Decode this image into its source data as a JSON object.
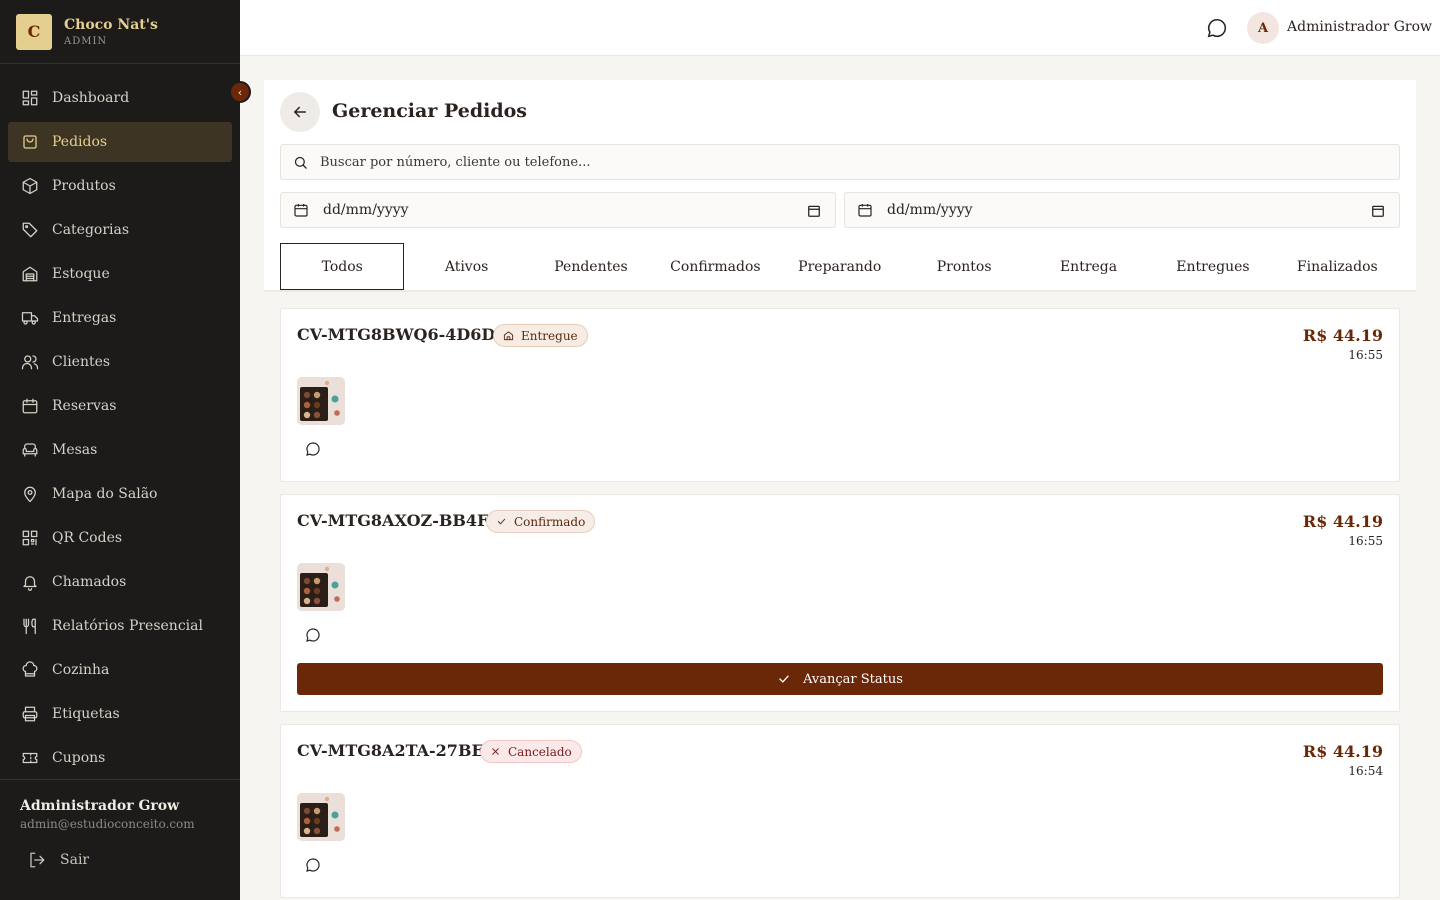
{
  "brand": {
    "initial": "C",
    "name": "Choco Nat's",
    "subtitle": "ADMIN"
  },
  "sidebar": {
    "items": [
      {
        "label": "Dashboard",
        "icon": "dashboard-icon"
      },
      {
        "label": "Pedidos",
        "icon": "shopping-bag-icon",
        "active": true
      },
      {
        "label": "Produtos",
        "icon": "package-icon"
      },
      {
        "label": "Categorias",
        "icon": "tag-icon"
      },
      {
        "label": "Estoque",
        "icon": "warehouse-icon"
      },
      {
        "label": "Entregas",
        "icon": "truck-icon"
      },
      {
        "label": "Clientes",
        "icon": "users-icon"
      },
      {
        "label": "Reservas",
        "icon": "calendar-icon"
      },
      {
        "label": "Mesas",
        "icon": "sofa-icon"
      },
      {
        "label": "Mapa do Salão",
        "icon": "map-pin-icon"
      },
      {
        "label": "QR Codes",
        "icon": "qr-code-icon"
      },
      {
        "label": "Chamados",
        "icon": "bell-icon"
      },
      {
        "label": "Relatórios Presencial",
        "icon": "utensils-icon"
      },
      {
        "label": "Cozinha",
        "icon": "chef-hat-icon"
      },
      {
        "label": "Etiquetas",
        "icon": "printer-icon"
      },
      {
        "label": "Cupons",
        "icon": "ticket-icon"
      }
    ],
    "collapse_glyph": "‹",
    "footer": {
      "name": "Administrador Grow",
      "email": "admin@estudioconceito.com",
      "logout_label": "Sair"
    }
  },
  "topbar": {
    "avatar_initial": "A",
    "user_name": "Administrador Grow"
  },
  "page": {
    "title": "Gerenciar Pedidos",
    "search_placeholder": "Buscar por número, cliente ou telefone...",
    "date_from": "dd/mm/yyyy",
    "date_to": "dd/mm/yyyy",
    "tabs": [
      "Todos",
      "Ativos",
      "Pendentes",
      "Confirmados",
      "Preparando",
      "Prontos",
      "Entrega",
      "Entregues",
      "Finalizados"
    ],
    "active_tab": 0
  },
  "orders": [
    {
      "code": "CV-MTG8BWQ6-4D6D",
      "status": "Entregue",
      "status_icon": "home-icon",
      "price": "R$ 44.19",
      "time": "16:55"
    },
    {
      "code": "CV-MTG8AXOZ-BB4F",
      "status": "Confirmado",
      "status_icon": "check-icon",
      "price": "R$ 44.19",
      "time": "16:55",
      "action_label": "Avançar Status"
    },
    {
      "code": "CV-MTG8A2TA-27BE",
      "status": "Cancelado",
      "status_icon": "x-icon",
      "price": "R$ 44.19",
      "time": "16:54"
    }
  ],
  "colors": {
    "sidebar_bg": "#1c1b1a",
    "accent_gold": "#e4cf8e",
    "brand_brown": "#6b2808",
    "page_bg": "#f7f5f2"
  }
}
